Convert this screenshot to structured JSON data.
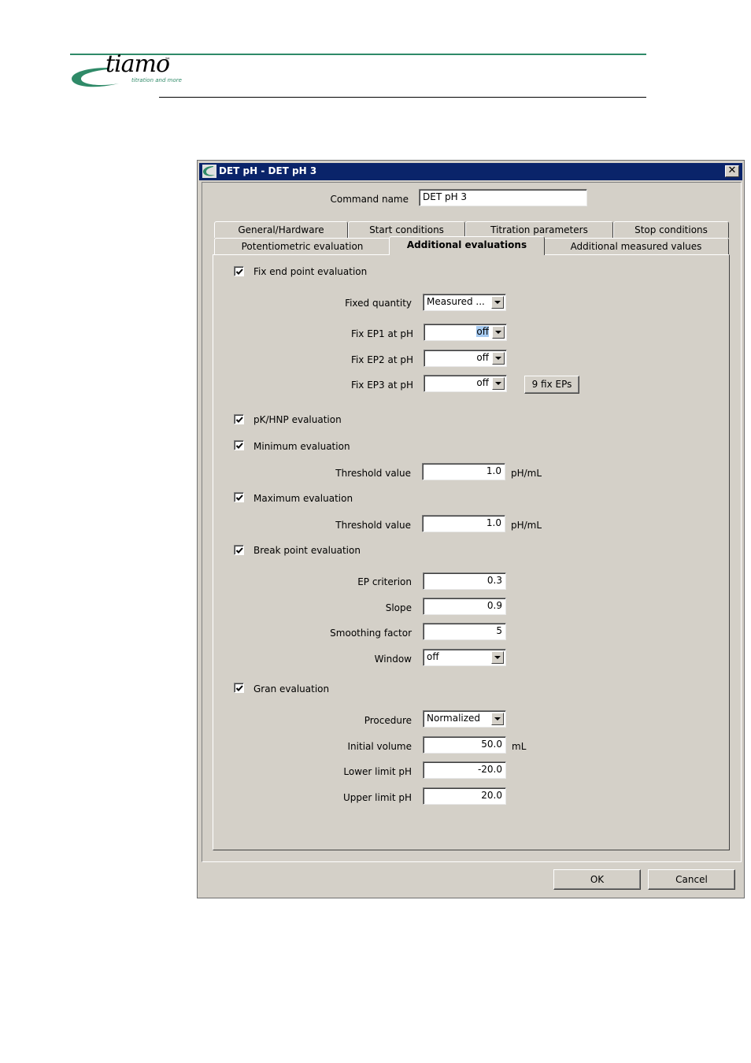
{
  "header": {
    "logo_word": "tiamo",
    "logo_tm": "™",
    "logo_tagline": "titration and more"
  },
  "dialog": {
    "title": "DET pH - DET pH 3",
    "close_glyph": "✕",
    "command_name_label": "Command name",
    "command_name_value": "DET pH 3",
    "tabs_row1": [
      "General/Hardware",
      "Start conditions",
      "Titration parameters",
      "Stop conditions"
    ],
    "tabs_row2": [
      "Potentiometric evaluation",
      "Additional evaluations",
      "Additional measured values"
    ],
    "active_tab": "Additional evaluations",
    "fix_ep": {
      "checkbox_label": "Fix end point evaluation",
      "checked": true,
      "fixed_quantity_label": "Fixed quantity",
      "fixed_quantity_value": "Measured ...",
      "ep1_label": "Fix EP1 at pH",
      "ep1_value": "off",
      "ep2_label": "Fix EP2 at pH",
      "ep2_value": "off",
      "ep3_label": "Fix EP3 at pH",
      "ep3_value": "off",
      "nine_fix_button": "9 fix EPs"
    },
    "pk_hnp": {
      "checkbox_label": "pK/HNP evaluation",
      "checked": true
    },
    "minimum": {
      "checkbox_label": "Minimum evaluation",
      "checked": true,
      "threshold_label": "Threshold value",
      "threshold_value": "1.0",
      "unit": "pH/mL"
    },
    "maximum": {
      "checkbox_label": "Maximum evaluation",
      "checked": true,
      "threshold_label": "Threshold value",
      "threshold_value": "1.0",
      "unit": "pH/mL"
    },
    "break_point": {
      "checkbox_label": "Break point evaluation",
      "checked": true,
      "ep_criterion_label": "EP criterion",
      "ep_criterion_value": "0.3",
      "slope_label": "Slope",
      "slope_value": "0.9",
      "smoothing_label": "Smoothing factor",
      "smoothing_value": "5",
      "window_label": "Window",
      "window_value": "off"
    },
    "gran": {
      "checkbox_label": "Gran evaluation",
      "checked": true,
      "procedure_label": "Procedure",
      "procedure_value": "Normalized",
      "initial_volume_label": "Initial volume",
      "initial_volume_value": "50.0",
      "initial_volume_unit": "mL",
      "lower_limit_label": "Lower limit pH",
      "lower_limit_value": "-20.0",
      "upper_limit_label": "Upper limit pH",
      "upper_limit_value": "20.0"
    },
    "ok_button": "OK",
    "cancel_button": "Cancel"
  },
  "colors": {
    "title_bar": "#0a246a",
    "dialog_face": "#d4d0c8",
    "brand_green": "#2f8a68"
  }
}
